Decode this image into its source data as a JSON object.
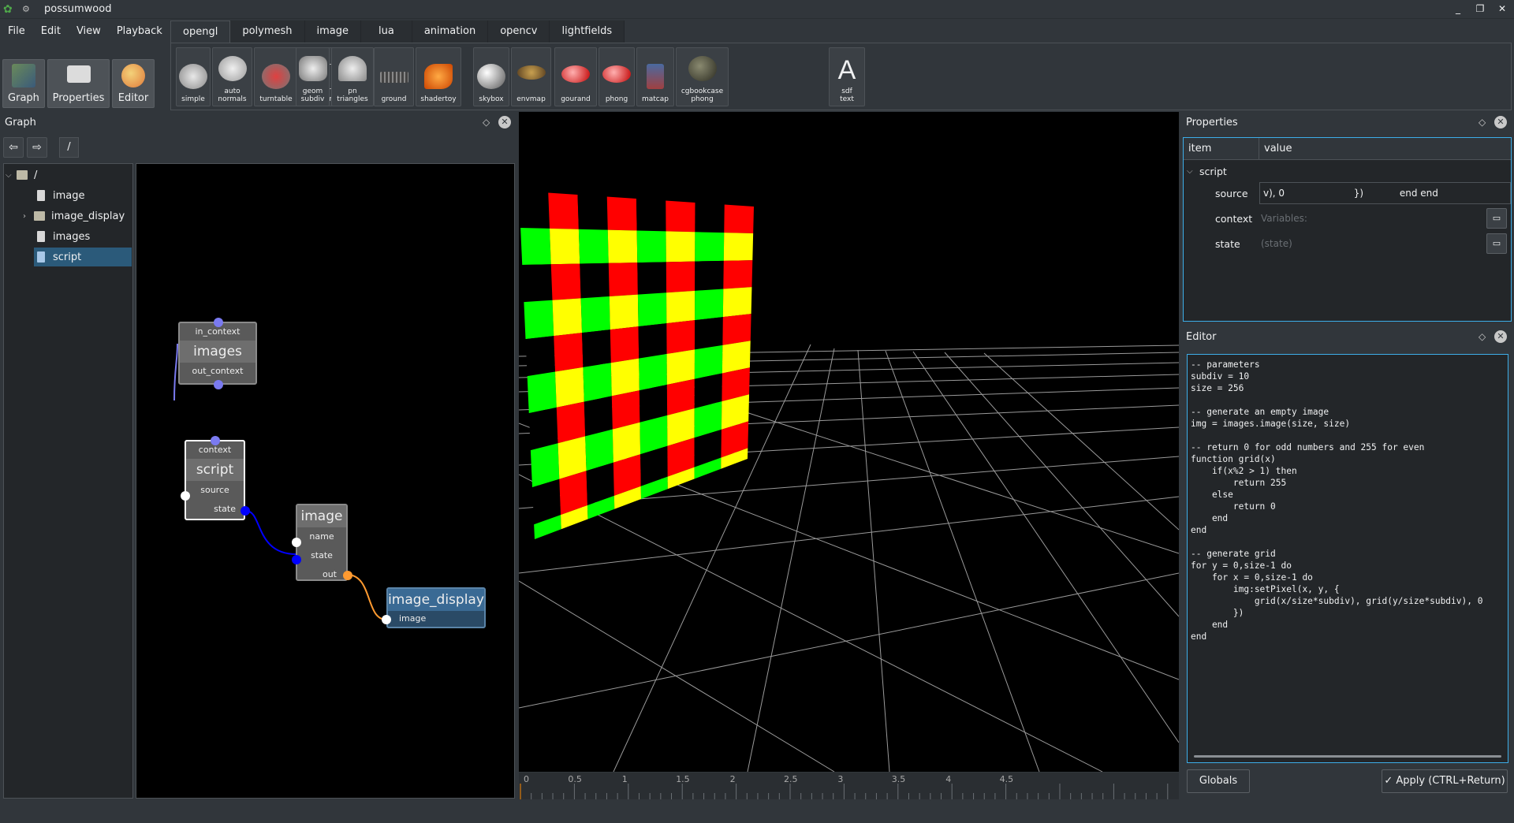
{
  "window": {
    "title": "possumwood",
    "controls": [
      "_",
      "❐",
      "✕"
    ]
  },
  "menu": [
    "File",
    "Edit",
    "View",
    "Playback"
  ],
  "mode_buttons": [
    {
      "label": "Graph",
      "icon": "graph-icon"
    },
    {
      "label": "Properties",
      "icon": "properties-icon"
    },
    {
      "label": "Editor",
      "icon": "editor-palette-icon"
    }
  ],
  "tabs": [
    "opengl",
    "polymesh",
    "image",
    "lua",
    "animation",
    "opencv",
    "lightfields"
  ],
  "active_tab": "opengl",
  "tools": [
    {
      "label": "simple"
    },
    {
      "label": "auto\nnormals"
    },
    {
      "label": "turntable"
    },
    {
      "label": "wireframe"
    },
    {
      "label": "geom\nsubdiv"
    },
    {
      "label": "pn\ntriangles"
    },
    {
      "label": "ground"
    },
    {
      "label": "shadertoy"
    },
    {
      "label": "skybox"
    },
    {
      "label": "envmap"
    },
    {
      "label": "gourand"
    },
    {
      "label": "phong"
    },
    {
      "label": "matcap"
    },
    {
      "label": "cgbookcase\nphong"
    },
    {
      "label": "sdf\ntext"
    }
  ],
  "graph_panel": {
    "title": "Graph",
    "path": "/",
    "tree": [
      {
        "label": "/",
        "type": "folder"
      },
      {
        "label": "image",
        "type": "node"
      },
      {
        "label": "image_display",
        "type": "folder"
      },
      {
        "label": "images",
        "type": "node"
      },
      {
        "label": "script",
        "type": "node",
        "selected": true
      }
    ]
  },
  "nodes": {
    "images": {
      "title": "images",
      "ports": [
        "in_context",
        "out_context"
      ]
    },
    "script": {
      "title": "script",
      "ports": [
        "context",
        "source",
        "state"
      ]
    },
    "image": {
      "title": "image",
      "ports": [
        "name",
        "state",
        "out"
      ]
    },
    "image_display": {
      "title": "image_display",
      "ports": [
        "image"
      ]
    }
  },
  "timeline": {
    "ticks": [
      "0",
      "0.5",
      "1",
      "1.5",
      "2",
      "2.5",
      "3",
      "3.5",
      "4",
      "4.5"
    ]
  },
  "properties_panel": {
    "title": "Properties",
    "columns": [
      "item",
      "value"
    ],
    "group": "script",
    "rows": [
      {
        "item": "source",
        "value": "v), 0                       })            end end"
      },
      {
        "item": "context",
        "value": "Variables:"
      },
      {
        "item": "state",
        "value": "(state)"
      }
    ]
  },
  "editor_panel": {
    "title": "Editor",
    "code": "-- parameters\nsubdiv = 10\nsize = 256\n\n-- generate an empty image\nimg = images.image(size, size)\n\n-- return 0 for odd numbers and 255 for even\nfunction grid(x)\n    if(x%2 > 1) then\n        return 255\n    else\n        return 0\n    end\nend\n\n-- generate grid\nfor y = 0,size-1 do\n    for x = 0,size-1 do\n        img:setPixel(x, y, {\n            grid(x/size*subdiv), grid(y/size*subdiv), 0\n        })\n    end\nend",
    "globals_label": "Globals",
    "apply_label": "Apply (CTRL+Return)"
  },
  "colors": {
    "accent": "#3daee9",
    "bg": "#31363b",
    "grid_red": "#ff0000",
    "grid_yellow": "#ffff00",
    "grid_green": "#00ff00"
  }
}
